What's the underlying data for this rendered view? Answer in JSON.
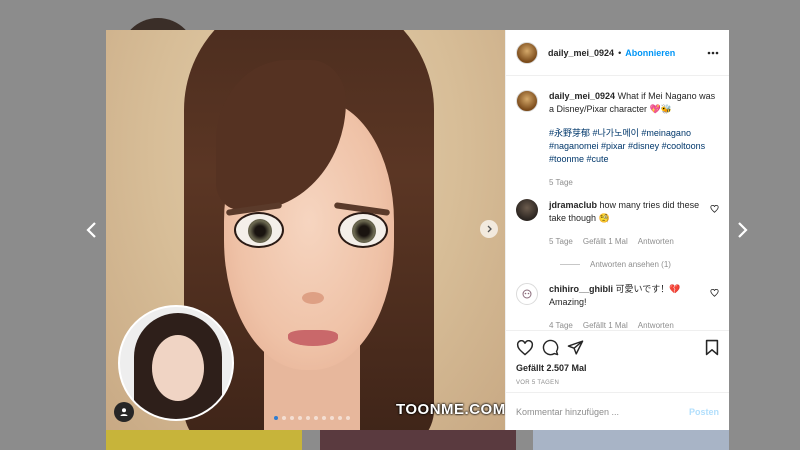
{
  "post": {
    "username": "daily_mei_0924",
    "follow_label": "Abonnieren",
    "separator": "•",
    "caption": "What if Mei Nagano was a Disney/Pixar character 💖🐝",
    "hashtags": "#永野芽郁 #나가노메이 #meinagano #naganomei #pixar #disney #cooltoons #toonme #cute",
    "caption_time": "5 Tage",
    "likes": "Gefällt 2.507 Mal",
    "posted_ago": "VOR 5 TAGEN",
    "watermark": "TOONME.COM",
    "carousel": {
      "total": 10,
      "active_index": 0
    }
  },
  "comments": [
    {
      "username": "jdramaclub",
      "text": "how many tries did these take though 🧐",
      "time": "5 Tage",
      "likes": "Gefällt 1 Mal",
      "reply": "Antworten",
      "view_replies": "Antworten ansehen (1)"
    },
    {
      "username": "chihiro__ghibli",
      "text": "可愛いです！💔 Amazing!",
      "time": "4 Tage",
      "likes": "Gefällt 1 Mal",
      "reply": "Antworten"
    }
  ],
  "comment_box": {
    "placeholder": "Kommentar hinzufügen ...",
    "post_label": "Posten"
  },
  "colors": {
    "accent": "#0095f6",
    "post_disabled": "#b2dffc",
    "text": "#262626",
    "muted": "#8e8e8e",
    "backdrop": "#8c8c8c"
  },
  "icons": [
    "chevron-left-icon",
    "chevron-right-icon",
    "more-icon",
    "heart-icon",
    "comment-icon",
    "share-icon",
    "bookmark-icon",
    "user-tag-icon"
  ]
}
